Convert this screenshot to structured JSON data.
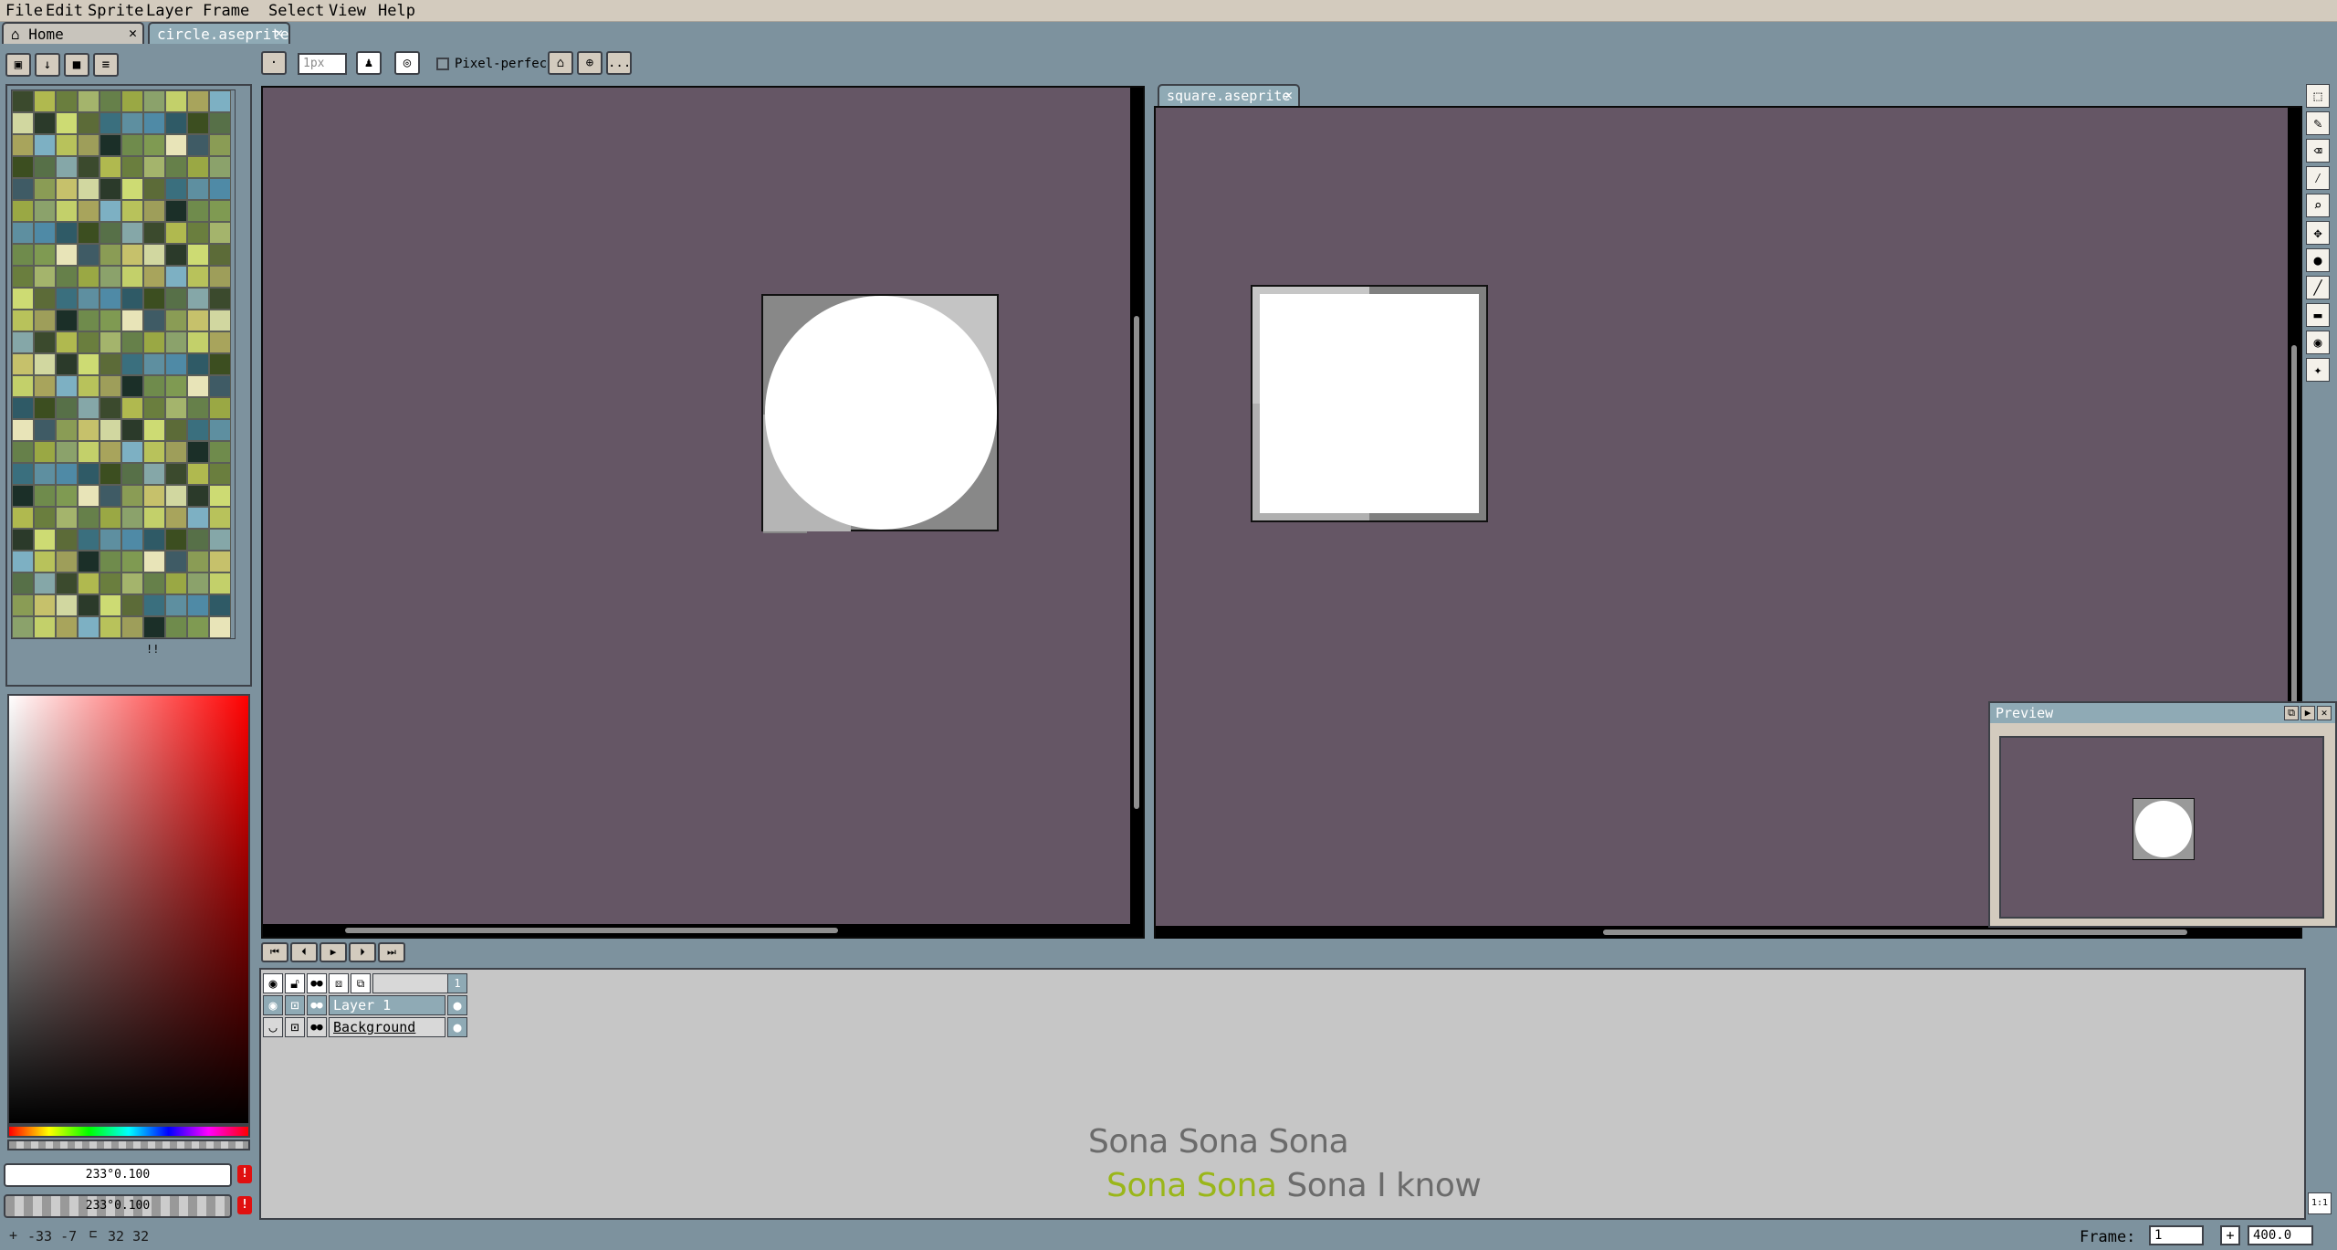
{
  "menubar": {
    "items": [
      "File",
      "Edit",
      "Sprite",
      "Layer",
      "Frame",
      "Select",
      "View",
      "Help"
    ]
  },
  "tabs": [
    {
      "label": "Home",
      "icon": "home-icon",
      "close": "✕"
    },
    {
      "label": "circle.aseprite",
      "close": "✕"
    }
  ],
  "toolbar": {
    "brush_size": "1px",
    "pixel_perfect_label": "Pixel-perfect",
    "more_label": "..."
  },
  "palette": {
    "colors": [
      "#3b4a2d",
      "#6f8b4c",
      "#2f5a66",
      "#7db0c3",
      "#5c6b38",
      "#9aa844",
      "#c6c16b",
      "#b0b94f",
      "#7f9a52",
      "#3c4e20",
      "#b8c25b",
      "#3a6f7e",
      "#8ba26b",
      "#d1d7a0",
      "#6a7e3e",
      "#e8e4b8",
      "#577048",
      "#9e9e5a",
      "#5e8fa0",
      "#c3d06a",
      "#2b3a2a",
      "#a4b46c",
      "#3f5b65",
      "#85a7a8",
      "#1b2f28",
      "#4f8aa6",
      "#a8a45c",
      "#cddb73",
      "#66804a",
      "#8a9c55"
    ],
    "footer_mark": "!!"
  },
  "colors": {
    "fg_value": "233°0.100",
    "bg_value": "233°0.100",
    "warn": "!"
  },
  "editors": [
    {
      "title": "",
      "canvas": "circle"
    },
    {
      "title": "square.aseprite",
      "close": "✕",
      "canvas": "square"
    }
  ],
  "preview": {
    "title": "Preview",
    "buttons": [
      "⧉",
      "▶",
      "✕"
    ]
  },
  "timeline": {
    "controls": [
      "⏮",
      "⏴",
      "▶",
      "⏵",
      "⏭"
    ],
    "frame_header": "1",
    "layers": [
      {
        "name": "Layer 1"
      },
      {
        "name": "Background"
      }
    ]
  },
  "lyrics": {
    "line1": "Sona Sona Sona",
    "line2_highlight": "Sona Sona",
    "line2_rest": "Sona I know",
    "highlight_color": "#9ab61a"
  },
  "status": {
    "coords": "-33  -7",
    "size": "32 32",
    "frame_label": "Frame:",
    "frame_value": "1",
    "zoom_value": "400.0",
    "plus": "+"
  },
  "right_tools": [
    "marquee-icon",
    "pencil-icon",
    "eraser-icon",
    "eyedropper-icon",
    "zoom-icon",
    "move-icon",
    "fill-icon",
    "line-icon",
    "rectangle-icon",
    "blur-icon",
    "spray-icon"
  ],
  "corner_button": "1:1"
}
